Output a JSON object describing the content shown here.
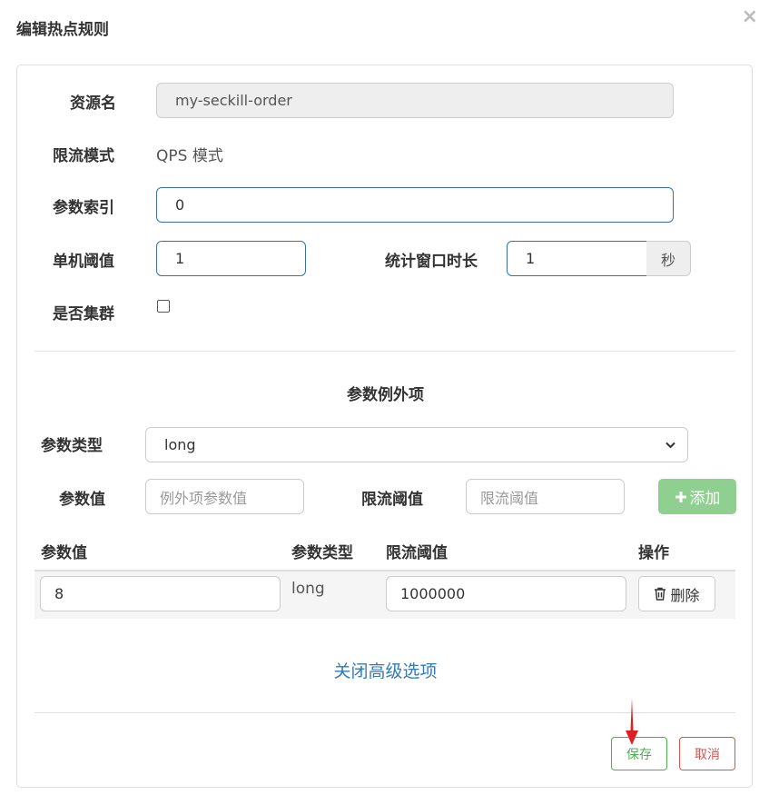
{
  "dialog": {
    "title": "编辑热点规则",
    "close_glyph": "×"
  },
  "form": {
    "resource_label": "资源名",
    "resource_value": "my-seckill-order",
    "mode_label": "限流模式",
    "mode_value": "QPS 模式",
    "param_index_label": "参数索引",
    "param_index_value": "0",
    "threshold_label": "单机阈值",
    "threshold_value": "1",
    "window_label": "统计窗口时长",
    "window_value": "1",
    "window_unit": "秒",
    "cluster_label": "是否集群",
    "cluster_checked": false
  },
  "exceptions": {
    "section_title": "参数例外项",
    "type_label": "参数类型",
    "type_selected": "long",
    "value_label": "参数值",
    "value_placeholder": "例外项参数值",
    "limit_label": "限流阈值",
    "limit_placeholder": "限流阈值",
    "add_label": "添加",
    "columns": [
      "参数值",
      "参数类型",
      "限流阈值",
      "操作"
    ],
    "rows": [
      {
        "value": "8",
        "type": "long",
        "limit": "1000000",
        "action": "删除"
      }
    ]
  },
  "advanced": {
    "toggle_label": "关闭高级选项"
  },
  "footer": {
    "save_label": "保存",
    "cancel_label": "取消"
  },
  "colors": {
    "primary_link": "#337ab7",
    "success": "#4cae4c",
    "danger": "#d9534f",
    "add_button": "#8fcf8f",
    "arrow": "#e02020"
  },
  "icons": {
    "close": "close-icon",
    "plus": "plus-icon",
    "trash": "trash-icon",
    "chevron": "chevron-down-icon"
  }
}
